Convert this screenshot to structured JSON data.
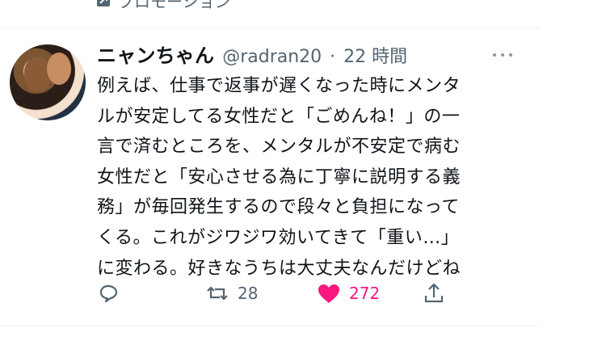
{
  "promotion_label": "プロモーション",
  "tweet": {
    "display_name": "ニャンちゃん",
    "handle": "@radran20",
    "separator": "·",
    "time": "22 時間",
    "text_lines": [
      "例えば、仕事で返事が遅くなった時にメンタ",
      "ルが安定してる女性だと「ごめんね！」の一",
      "言で済むところを、メンタルが不安定で病む",
      "女性だと「安心させる為に丁寧に説明する義",
      "務」が毎回発生するので段々と負担になって",
      "くる。これがジワジワ効いてきて「重い…」",
      "に変わる。好きなうちは大丈夫なんだけどね"
    ],
    "actions": {
      "retweets": "28",
      "likes": "272"
    }
  },
  "colors": {
    "text": "#0f1419",
    "secondary": "#536471",
    "like": "#f91880",
    "divider": "#eff3f4"
  },
  "icons": [
    "promotion-icon",
    "more-icon",
    "reply-icon",
    "retweet-icon",
    "heart-icon",
    "share-icon"
  ]
}
